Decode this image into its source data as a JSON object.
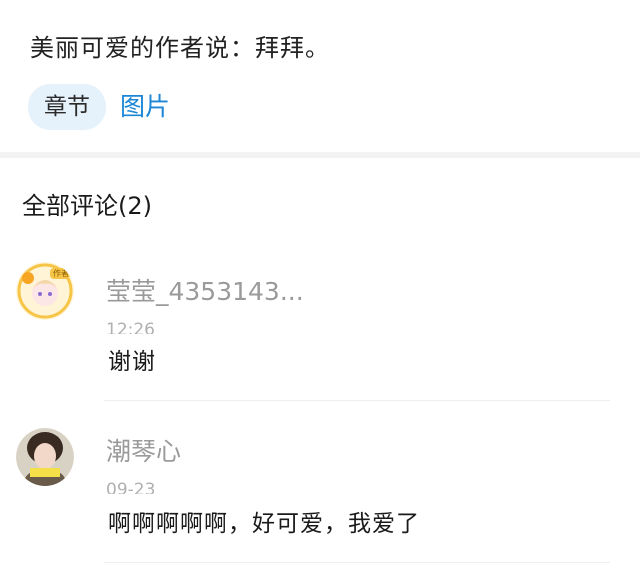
{
  "author_note": "美丽可爱的作者说：拜拜。",
  "tabs": {
    "active": "章节",
    "link": "图片"
  },
  "comments_title": "全部评论(2)",
  "comments": [
    {
      "username": "莹莹_4353143...",
      "time": "12:26",
      "content": "谢谢",
      "badge": "作者"
    },
    {
      "username": "潮琴心",
      "time": "09-23",
      "content": "啊啊啊啊啊，好可爱，我爱了"
    }
  ]
}
